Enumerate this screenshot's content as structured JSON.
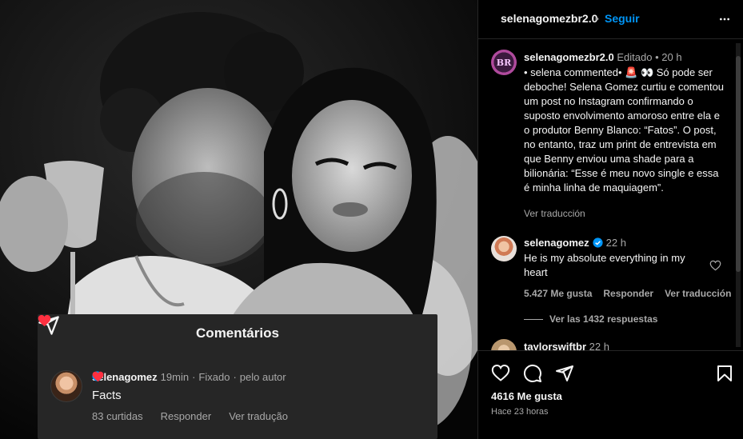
{
  "comment_card": {
    "title": "Comentários",
    "username": "selenagomez",
    "time": "19min",
    "pinned": "Fixado",
    "separator": "·",
    "by_author": "pelo autor",
    "text": "Facts",
    "likes": "83 curtidas",
    "reply": "Responder",
    "translate": "Ver tradução"
  },
  "header": {
    "username": "selenagomezbr2.0",
    "dot": "•",
    "follow": "Seguir"
  },
  "caption": {
    "username": "selenagomezbr2.0",
    "edited": "Editado",
    "dot": "•",
    "time": "20 h",
    "avatar_text": "BR",
    "text": "• selena commented• 🚨 👀 Só pode ser deboche! Selena Gomez curtiu e comentou um post no Instagram confirmando o suposto envolvimento amoroso entre ela e o produtor Benny Blanco: “Fatos”. O post, no entanto, traz um print de entrevista em que Benny enviou uma shade para a bilionária: “Esse é meu novo single e essa é minha linha de maquiagem”.",
    "translate": "Ver traducción"
  },
  "comment": {
    "username": "selenagomez",
    "time": "22 h",
    "text": "He is my absolute everything in my heart",
    "likes": "5.427 Me gusta",
    "reply": "Responder",
    "translate": "Ver traducción",
    "replies": "Ver las 1432 respuestas"
  },
  "comment_next": {
    "username": "taylorswiftbr",
    "time": "22 h"
  },
  "footer": {
    "likes": "4616 Me gusta",
    "ago": "Hace 23 horas"
  },
  "colors": {
    "accent": "#0095f6",
    "heart": "#ff3040",
    "panel_bg": "#000000",
    "card_bg": "#262626"
  }
}
